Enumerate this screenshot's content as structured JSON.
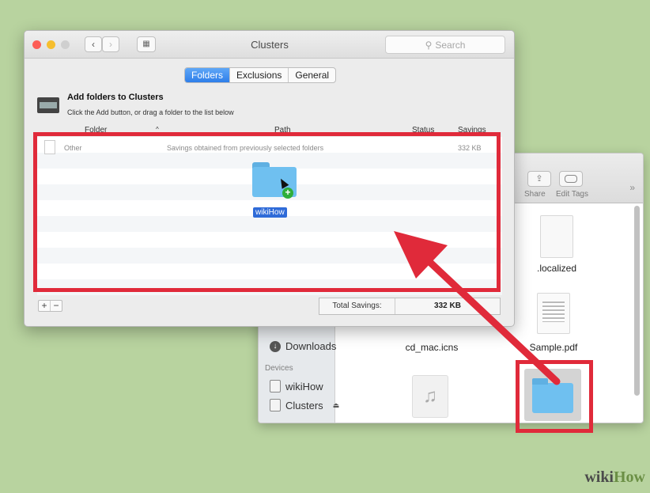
{
  "clusters_window": {
    "title": "Clusters",
    "search_placeholder": "Search",
    "tabs": [
      "Folders",
      "Exclusions",
      "General"
    ],
    "active_tab": "Folders",
    "heading": "Add folders to Clusters",
    "subheading": "Click the Add button, or drag a folder to the list below",
    "columns": [
      "Folder",
      "Path",
      "Status",
      "Savings"
    ],
    "rows": [
      {
        "folder": "Other",
        "path": "Savings obtained from previously selected folders",
        "status": "",
        "savings": "332 KB"
      }
    ],
    "drag_label": "wikiHow",
    "total_label": "Total Savings:",
    "total_value": "332 KB",
    "add_symbol": "+",
    "remove_symbol": "−"
  },
  "finder_window": {
    "toolbar": {
      "share": "Share",
      "edit_tags": "Edit Tags",
      "more": "»"
    },
    "sidebar": {
      "downloads": "Downloads",
      "devices_header": "Devices",
      "devices": [
        "wikiHow",
        "Clusters"
      ]
    },
    "files": [
      ".localized",
      "cd_mac.icns",
      "Sample.pdf"
    ]
  },
  "watermark": {
    "wiki": "wiki",
    "how": "How"
  },
  "colors": {
    "highlight_red": "#e02a3a",
    "folder_blue": "#6fc0f0",
    "tab_blue": "#2e7ee9"
  }
}
